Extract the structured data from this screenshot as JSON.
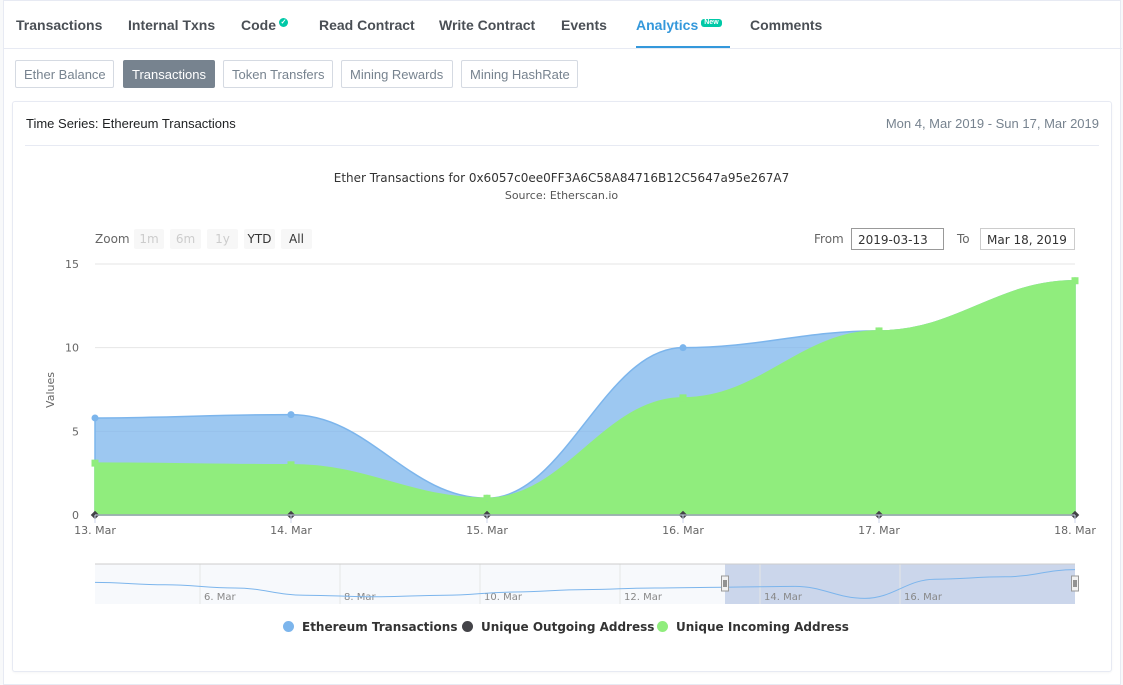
{
  "tabs": [
    {
      "label": "Transactions"
    },
    {
      "label": "Internal Txns"
    },
    {
      "label": "Code"
    },
    {
      "label": "Read Contract"
    },
    {
      "label": "Write Contract"
    },
    {
      "label": "Events"
    },
    {
      "label": "Analytics",
      "badge": "New"
    },
    {
      "label": "Comments"
    }
  ],
  "active_tab": "Analytics",
  "subtabs": [
    {
      "label": "Ether Balance"
    },
    {
      "label": "Transactions"
    },
    {
      "label": "Token Transfers"
    },
    {
      "label": "Mining Rewards"
    },
    {
      "label": "Mining HashRate"
    }
  ],
  "active_subtab": "Transactions",
  "panel": {
    "title": "Time Series: Ethereum Transactions",
    "date_range": "Mon 4, Mar 2019 - Sun 17, Mar 2019"
  },
  "chart_ui": {
    "zoom_label": "Zoom",
    "zoom_options": [
      {
        "label": "1m",
        "enabled": false
      },
      {
        "label": "6m",
        "enabled": false
      },
      {
        "label": "1y",
        "enabled": false
      },
      {
        "label": "YTD",
        "enabled": true
      },
      {
        "label": "All",
        "enabled": true
      }
    ],
    "from_label": "From",
    "from_value": "2019-03-13",
    "to_label": "To",
    "to_value": "Mar 18, 2019",
    "navigator_ticks": [
      "6. Mar",
      "8. Mar",
      "10. Mar",
      "12. Mar",
      "14. Mar",
      "16. Mar"
    ]
  },
  "colors": {
    "accent": "#3498db",
    "ethereum_transactions": "#7cb5ec",
    "unique_outgoing": "#434348",
    "unique_incoming": "#90ed7d"
  },
  "chart_data": {
    "type": "area",
    "title": "Ether Transactions for 0x6057c0ee0FF3A6C58A84716B12C5647a95e267A7",
    "subtitle": "Source: Etherscan.io",
    "ylabel": "Values",
    "x": [
      "13. Mar",
      "14. Mar",
      "15. Mar",
      "16. Mar",
      "17. Mar",
      "18. Mar"
    ],
    "yticks": [
      0,
      5,
      10,
      15
    ],
    "ylim": [
      0,
      15
    ],
    "grid": true,
    "legend": "bottom-center",
    "series": [
      {
        "name": "Ethereum Transactions",
        "color": "#7cb5ec",
        "values": [
          5.8,
          6,
          1,
          10,
          11,
          14
        ]
      },
      {
        "name": "Unique Outgoing Address",
        "color": "#434348",
        "values": [
          0,
          0,
          0,
          0,
          0,
          0
        ]
      },
      {
        "name": "Unique Incoming Address",
        "color": "#90ed7d",
        "values": [
          3.1,
          3,
          1,
          7,
          11,
          14
        ]
      }
    ]
  }
}
